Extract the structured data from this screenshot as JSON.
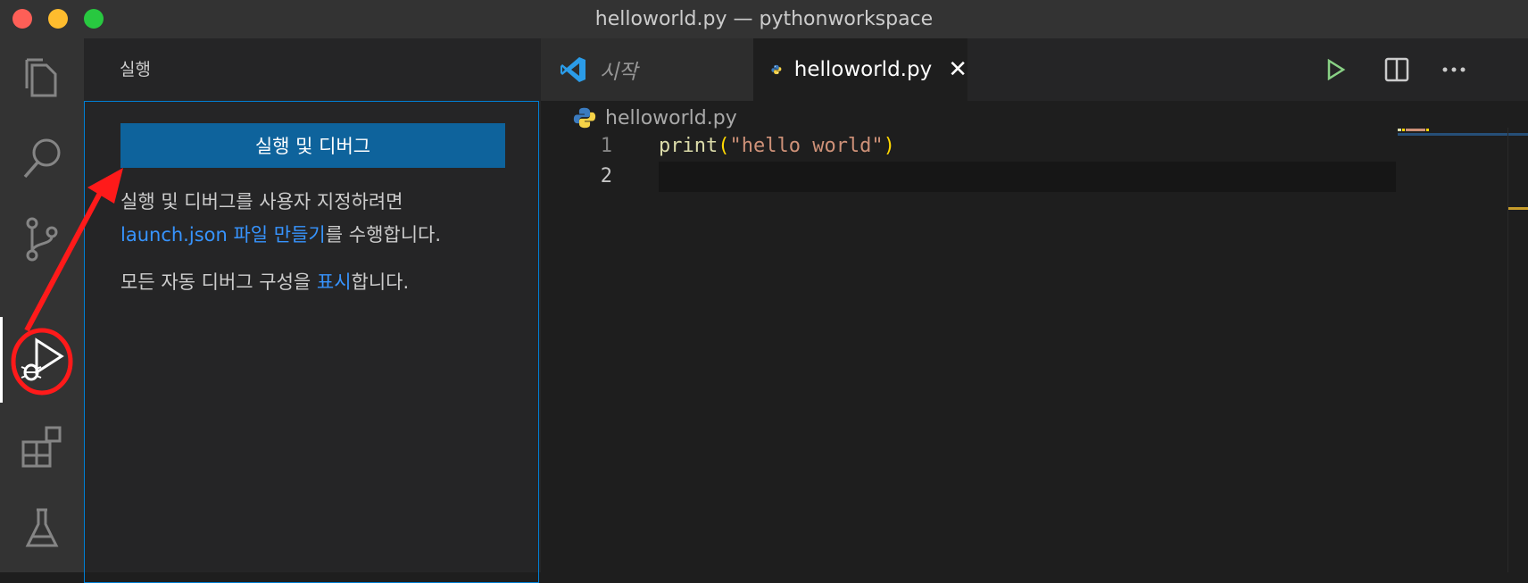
{
  "window": {
    "title": "helloworld.py — pythonworkspace"
  },
  "activity_bar": {
    "items": [
      {
        "icon": "files-icon"
      },
      {
        "icon": "search-icon"
      },
      {
        "icon": "source-control-icon"
      },
      {
        "icon": "run-debug-icon",
        "active": true
      },
      {
        "icon": "extensions-icon"
      },
      {
        "icon": "testing-icon"
      }
    ]
  },
  "sidebar": {
    "title": "실행",
    "run_button_label": "실행 및 디버그",
    "para1_text": "실행 및 디버그를 사용자 지정하려면",
    "para1_link": "launch.json 파일 만들기",
    "para1_suffix": "를 수행합니다.",
    "para2_prefix": "모든 자동 디버그 구성을 ",
    "para2_link": "표시",
    "para2_suffix": "합니다."
  },
  "tabs": [
    {
      "label": "시작",
      "icon": "vscode-logo-icon"
    },
    {
      "label": "helloworld.py",
      "icon": "python-icon",
      "active": true
    }
  ],
  "breadcrumb": {
    "file": "helloworld.py"
  },
  "code": {
    "lines": [
      {
        "number": "1",
        "fn": "print",
        "open": "(",
        "string": "\"hello world\"",
        "close": ")"
      },
      {
        "number": "2"
      }
    ]
  },
  "colors": {
    "accent_blue": "#0e639c",
    "link_blue": "#3794ff",
    "annotation_red": "#ff1a1a",
    "run_green": "#89d185"
  }
}
